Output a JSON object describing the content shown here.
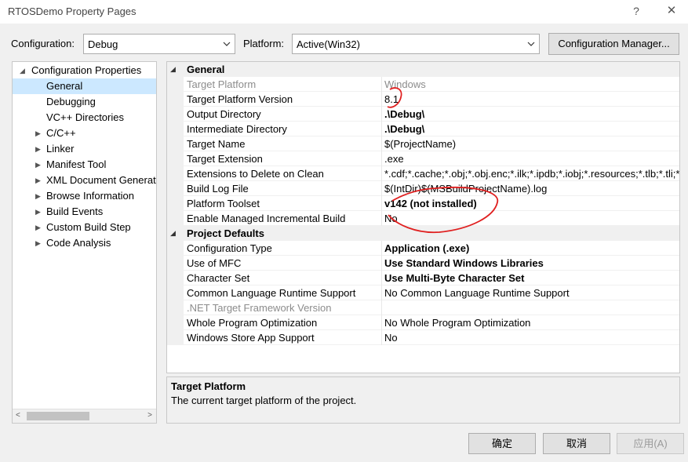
{
  "window": {
    "title": "RTOSDemo Property Pages",
    "help_glyph": "?",
    "close_glyph": "✕"
  },
  "toolbar": {
    "configuration_label": "Configuration:",
    "configuration_value": "Debug",
    "platform_label": "Platform:",
    "platform_value": "Active(Win32)",
    "config_manager_label": "Configuration Manager..."
  },
  "tree": {
    "root": "Configuration Properties",
    "items": [
      {
        "label": "General",
        "selected": true,
        "expandable": false
      },
      {
        "label": "Debugging",
        "expandable": false
      },
      {
        "label": "VC++ Directories",
        "expandable": false
      },
      {
        "label": "C/C++",
        "expandable": true
      },
      {
        "label": "Linker",
        "expandable": true
      },
      {
        "label": "Manifest Tool",
        "expandable": true
      },
      {
        "label": "XML Document Generat",
        "expandable": true
      },
      {
        "label": "Browse Information",
        "expandable": true
      },
      {
        "label": "Build Events",
        "expandable": true
      },
      {
        "label": "Custom Build Step",
        "expandable": true
      },
      {
        "label": "Code Analysis",
        "expandable": true
      }
    ]
  },
  "grid": {
    "sections": [
      {
        "title": "General",
        "rows": [
          {
            "name": "Target Platform",
            "value": "Windows",
            "dim": true
          },
          {
            "name": "Target Platform Version",
            "value": "8.1"
          },
          {
            "name": "Output Directory",
            "value": ".\\Debug\\",
            "bold": true
          },
          {
            "name": "Intermediate Directory",
            "value": ".\\Debug\\",
            "bold": true
          },
          {
            "name": "Target Name",
            "value": "$(ProjectName)"
          },
          {
            "name": "Target Extension",
            "value": ".exe"
          },
          {
            "name": "Extensions to Delete on Clean",
            "value": "*.cdf;*.cache;*.obj;*.obj.enc;*.ilk;*.ipdb;*.iobj;*.resources;*.tlb;*.tli;*.t"
          },
          {
            "name": "Build Log File",
            "value": "$(IntDir)$(MSBuildProjectName).log"
          },
          {
            "name": "Platform Toolset",
            "value": "v142 (not installed)",
            "bold": true
          },
          {
            "name": "Enable Managed Incremental Build",
            "value": "No"
          }
        ]
      },
      {
        "title": "Project Defaults",
        "rows": [
          {
            "name": "Configuration Type",
            "value": "Application (.exe)",
            "bold": true
          },
          {
            "name": "Use of MFC",
            "value": "Use Standard Windows Libraries",
            "bold": true
          },
          {
            "name": "Character Set",
            "value": "Use Multi-Byte Character Set",
            "bold": true
          },
          {
            "name": "Common Language Runtime Support",
            "value": "No Common Language Runtime Support"
          },
          {
            "name": ".NET Target Framework Version",
            "value": "",
            "dim": true
          },
          {
            "name": "Whole Program Optimization",
            "value": "No Whole Program Optimization"
          },
          {
            "name": "Windows Store App Support",
            "value": "No"
          }
        ]
      }
    ]
  },
  "description": {
    "title": "Target Platform",
    "text": "The current target platform of the project."
  },
  "footer": {
    "ok": "确定",
    "cancel": "取消",
    "apply": "应用(A)"
  },
  "annotation_color": "#e02020"
}
